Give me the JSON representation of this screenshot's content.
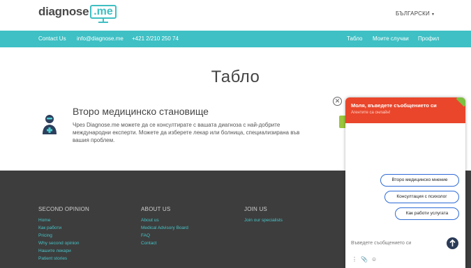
{
  "header": {
    "logo_word": "diagnose",
    "logo_screen": ".me",
    "language": "БЪЛГАРСКИ",
    "language_caret": "▾"
  },
  "nav": {
    "contact": "Contact Us",
    "email": "info@diagnose.me",
    "phone": "+421 2/210 250 74",
    "dashboard": "Табло",
    "my_cases": "Моите случаи",
    "profile": "Профил"
  },
  "main": {
    "title": "Табло",
    "section_title": "Второ медицинско становище",
    "section_text": "Чрез Diagnose.me можете да се консултирате с вашата диагноза с най-добрите международни експерти. Можете да изберете лекар или болница, специализирана във вашия проблем."
  },
  "footer": {
    "columns": [
      {
        "heading": "SECOND OPINION",
        "links": [
          "Home",
          "Как работи",
          "Pricing",
          "Why second opinion",
          "Нашите лекари",
          "Patient stories"
        ]
      },
      {
        "heading": "ABOUT US",
        "links": [
          "About us",
          "Medical Advisory Board",
          "FAQ",
          "Contact"
        ]
      },
      {
        "heading": "JOIN US",
        "links": [
          "Join our specialists"
        ]
      }
    ]
  },
  "chat": {
    "close": "✕",
    "title": "Моля, въведете съобщението си",
    "subtitle": "Агентите са онлайн!",
    "options": [
      "Второ медицинско мнение",
      "Консултация с психолог",
      "Как работи услугата"
    ],
    "input_placeholder": "Въведете съобщението си",
    "tools": [
      "⋮",
      "📎",
      "☺"
    ]
  },
  "colors": {
    "teal": "#3ec0c4",
    "chat_header": "#e9462b",
    "footer_bg": "#3d3d3d",
    "chat_option_border": "#2e6bd6",
    "send_button": "#2a3b57"
  }
}
